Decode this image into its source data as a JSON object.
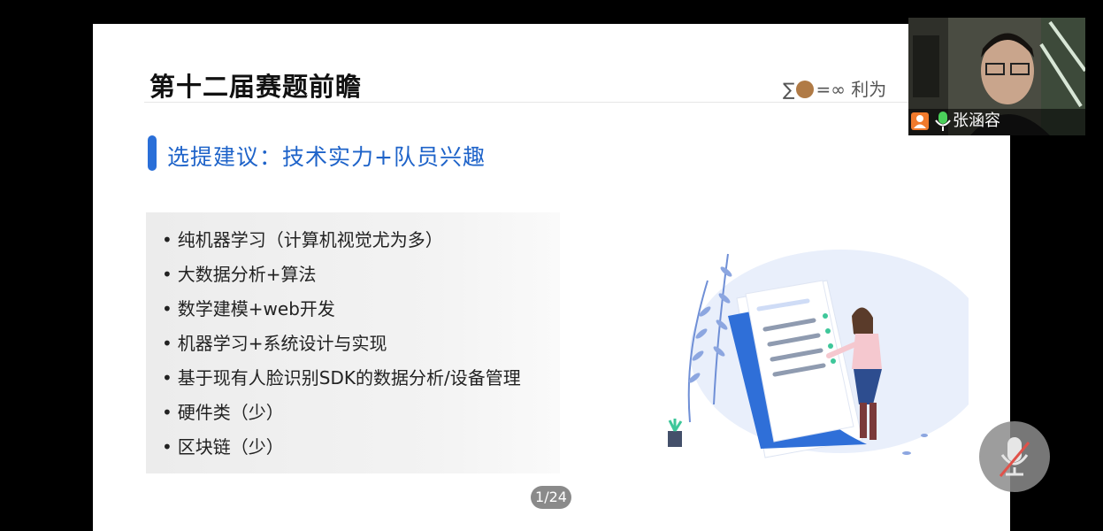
{
  "slide": {
    "title": "第十二届赛题前瞻",
    "brand_text_before": "∑",
    "brand_text_after": "=∞ 利为",
    "subtitle": "选提建议：技术实力+队员兴趣",
    "bullets": [
      "纯机器学习（计算机视觉尤为多）",
      "大数据分析+算法",
      "数学建模+web开发",
      "机器学习+系统设计与实现",
      "基于现有人脸识别SDK的数据分析/设备管理",
      "硬件类（少）",
      "区块链（少）"
    ],
    "bullet_marker": "•",
    "page_indicator": "1/24"
  },
  "video_call": {
    "participant_name": "张涵容",
    "user_icon": "user-icon",
    "mic_icon": "mic-active-icon",
    "mute_button_icon": "mic-muted-icon"
  },
  "colors": {
    "accent_blue": "#2a6fd8",
    "subtitle_blue": "#1e63c9",
    "participant_badge": "#f07a2c"
  }
}
